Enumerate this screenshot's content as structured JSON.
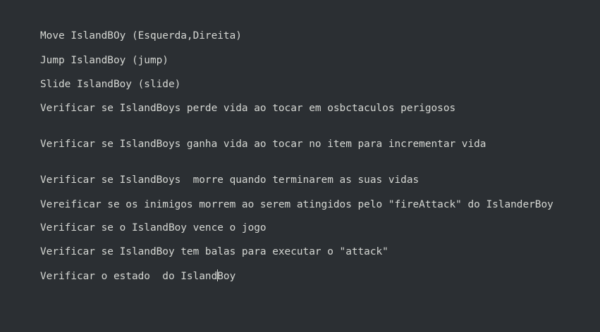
{
  "document": {
    "lines": [
      "Move IslandBOy (Esquerda,Direita)",
      "Jump IslandBoy (jump)",
      "Slide IslandBoy (slide)",
      "Verificar se IslandBoys perde vida ao tocar em osbctaculos perigosos",
      "Verificar se IslandBoys ganha vida ao tocar no item para incrementar vida",
      "Verificar se IslandBoys  morre quando terminarem as suas vidas",
      "Vereificar se os inimigos morrem ao serem atingidos pelo \"fireAttack\" do IslanderBoy",
      "Verificar se o IslandBoy vence o jogo",
      "Verificar se IslandBoy tem balas para executar o \"attack\""
    ],
    "last_line": {
      "before_caret": "Verificar o estado  do Island",
      "after_caret": "Boy"
    }
  },
  "colors": {
    "background": "#2b2f33",
    "text": "#d6d8d4"
  }
}
